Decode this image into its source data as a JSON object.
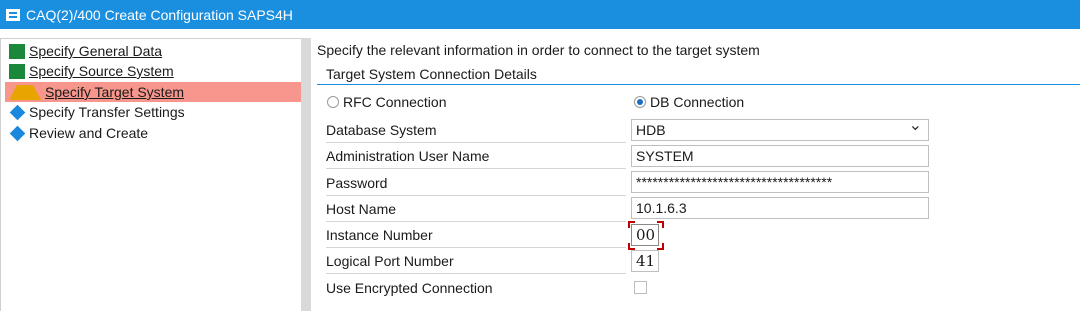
{
  "window": {
    "title": "CAQ(2)/400 Create Configuration SAPS4H"
  },
  "steps": [
    {
      "label": "Specify General Data",
      "status": "done"
    },
    {
      "label": "Specify Source System",
      "status": "done"
    },
    {
      "label": "Specify Target System",
      "status": "current"
    },
    {
      "label": "Specify Transfer Settings",
      "status": "pending"
    },
    {
      "label": "Review and Create",
      "status": "pending"
    }
  ],
  "main": {
    "intro": "Specify the relevant information in order to connect to the target system",
    "section_title": "Target System Connection Details",
    "connection": {
      "rfc_label": "RFC Connection",
      "db_label": "DB Connection",
      "selected": "DB Connection"
    },
    "fields": {
      "database_system": {
        "label": "Database System",
        "value": "HDB"
      },
      "admin_user": {
        "label": "Administration User Name",
        "value": "SYSTEM"
      },
      "password": {
        "label": "Password",
        "value": "************************************"
      },
      "host_name": {
        "label": "Host Name",
        "value": "10.1.6.3"
      },
      "instance_number": {
        "label": "Instance Number",
        "value": "00"
      },
      "logical_port": {
        "label": "Logical Port Number",
        "value": "41"
      },
      "encrypted": {
        "label": "Use Encrypted Connection",
        "checked": false
      }
    }
  },
  "colors": {
    "titlebar": "#1a8fe0",
    "step_done": "#19883b",
    "step_current_bg": "#f7968c",
    "step_warning": "#e8a400",
    "step_pending": "#1a88dd"
  }
}
